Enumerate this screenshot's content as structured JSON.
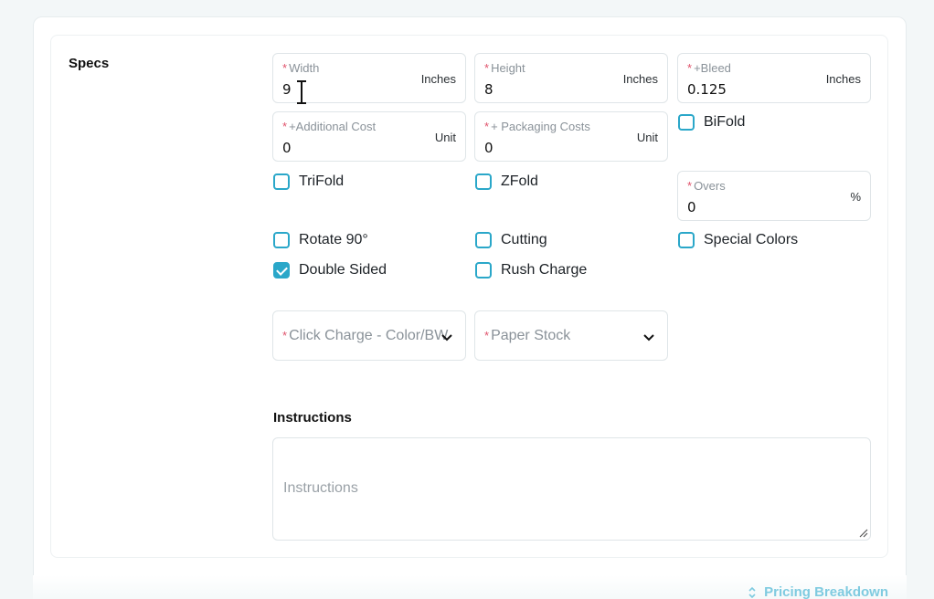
{
  "section": {
    "title": "Specs"
  },
  "fields": {
    "width": {
      "label": "Width",
      "unit": "Inches",
      "value": "9"
    },
    "height": {
      "label": "Height",
      "unit": "Inches",
      "value": "8"
    },
    "bleed": {
      "label": "+Bleed",
      "unit": "Inches",
      "value": "0.125"
    },
    "additional_cost": {
      "label": "+Additional Cost",
      "unit": "Unit",
      "value": "0"
    },
    "packaging_costs": {
      "label": "+ Packaging Costs",
      "unit": "Unit",
      "value": "0"
    },
    "overs": {
      "label": "Overs",
      "unit": "%",
      "value": "0"
    }
  },
  "required_marker": "*",
  "checkboxes": {
    "bifold": {
      "label": "BiFold",
      "checked": false
    },
    "trifold": {
      "label": "TriFold",
      "checked": false
    },
    "zfold": {
      "label": "ZFold",
      "checked": false
    },
    "rotate": {
      "label": "Rotate 90°",
      "checked": false
    },
    "cutting": {
      "label": "Cutting",
      "checked": false
    },
    "special_colors": {
      "label": "Special Colors",
      "checked": false
    },
    "double_sided": {
      "label": "Double Sided",
      "checked": true
    },
    "rush_charge": {
      "label": "Rush Charge",
      "checked": false
    }
  },
  "selects": {
    "click_charge": {
      "placeholder": "Click Charge - Color/BW"
    },
    "paper_stock": {
      "placeholder": "Paper Stock"
    }
  },
  "instructions": {
    "title": "Instructions",
    "placeholder": "Instructions"
  },
  "footer": {
    "pricing_breakdown": "Pricing Breakdown"
  },
  "colors": {
    "accent": "#2aa7c9",
    "required": "#e0526b"
  }
}
